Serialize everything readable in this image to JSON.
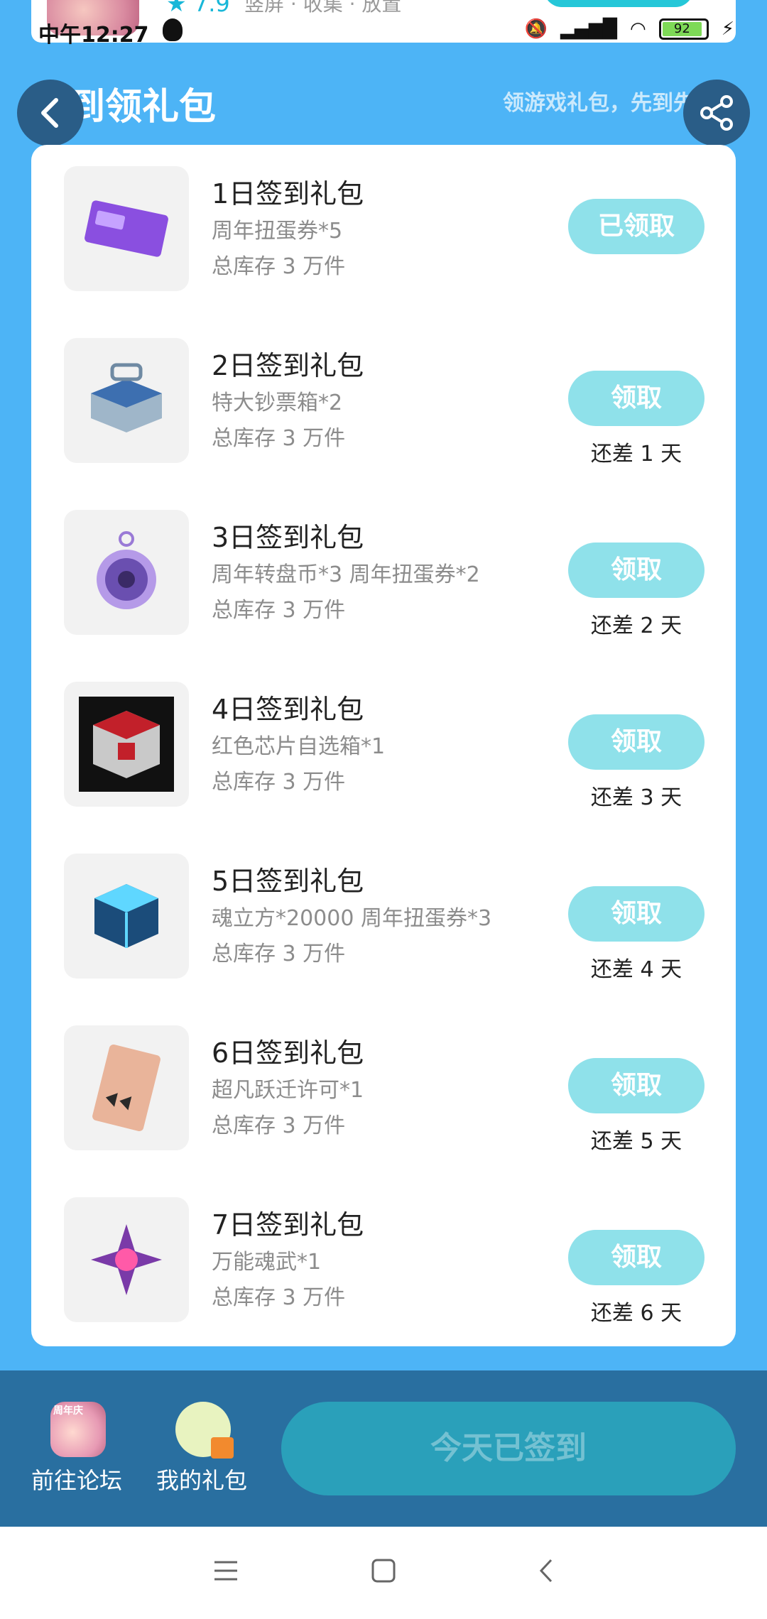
{
  "status_bar": {
    "time": "中午12:27",
    "battery": "92"
  },
  "peek": {
    "rating": "★ 7.9",
    "tags": "竖屏 · 收集 · 放置"
  },
  "header": {
    "title": "签到领礼包",
    "subtitle": "领游戏礼包，先到先得"
  },
  "gifts": [
    {
      "name": "1日签到礼包",
      "desc": "周年扭蛋券*5",
      "stock": "总库存 3 万件",
      "button": "已领取",
      "remain": ""
    },
    {
      "name": "2日签到礼包",
      "desc": "特大钞票箱*2",
      "stock": "总库存 3 万件",
      "button": "领取",
      "remain": "还差 1 天"
    },
    {
      "name": "3日签到礼包",
      "desc": "周年转盘币*3 周年扭蛋券*2",
      "stock": "总库存 3 万件",
      "button": "领取",
      "remain": "还差 2 天"
    },
    {
      "name": "4日签到礼包",
      "desc": "红色芯片自选箱*1",
      "stock": "总库存 3 万件",
      "button": "领取",
      "remain": "还差 3 天"
    },
    {
      "name": "5日签到礼包",
      "desc": "魂立方*20000 周年扭蛋券*3",
      "stock": "总库存 3 万件",
      "button": "领取",
      "remain": "还差 4 天"
    },
    {
      "name": "6日签到礼包",
      "desc": "超凡跃迁许可*1",
      "stock": "总库存 3 万件",
      "button": "领取",
      "remain": "还差 5 天"
    },
    {
      "name": "7日签到礼包",
      "desc": "万能魂武*1",
      "stock": "总库存 3 万件",
      "button": "领取",
      "remain": "还差 6 天"
    }
  ],
  "bottom_bar": {
    "forum_label": "前往论坛",
    "forum_icon_text": "周年庆",
    "my_gifts_label": "我的礼包",
    "signed_label": "今天已签到"
  },
  "colors": {
    "background": "#4db4f6",
    "button": "#8fe1ea",
    "bottom_bar": "#296fa0",
    "signed_button": "#2aa0ba"
  }
}
